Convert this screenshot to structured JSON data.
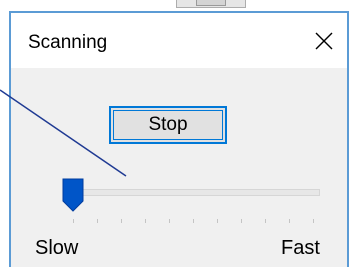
{
  "dialog": {
    "title": "Scanning",
    "close_icon": "close-icon",
    "stop_label": "Stop",
    "speed": {
      "min_label": "Slow",
      "max_label": "Fast",
      "value": 0,
      "tick_count": 11
    }
  },
  "colors": {
    "accent": "#0078d7",
    "dialog_border": "#5b9bd5",
    "thumb": "#0055c8",
    "callout_line": "#1f3a93"
  }
}
